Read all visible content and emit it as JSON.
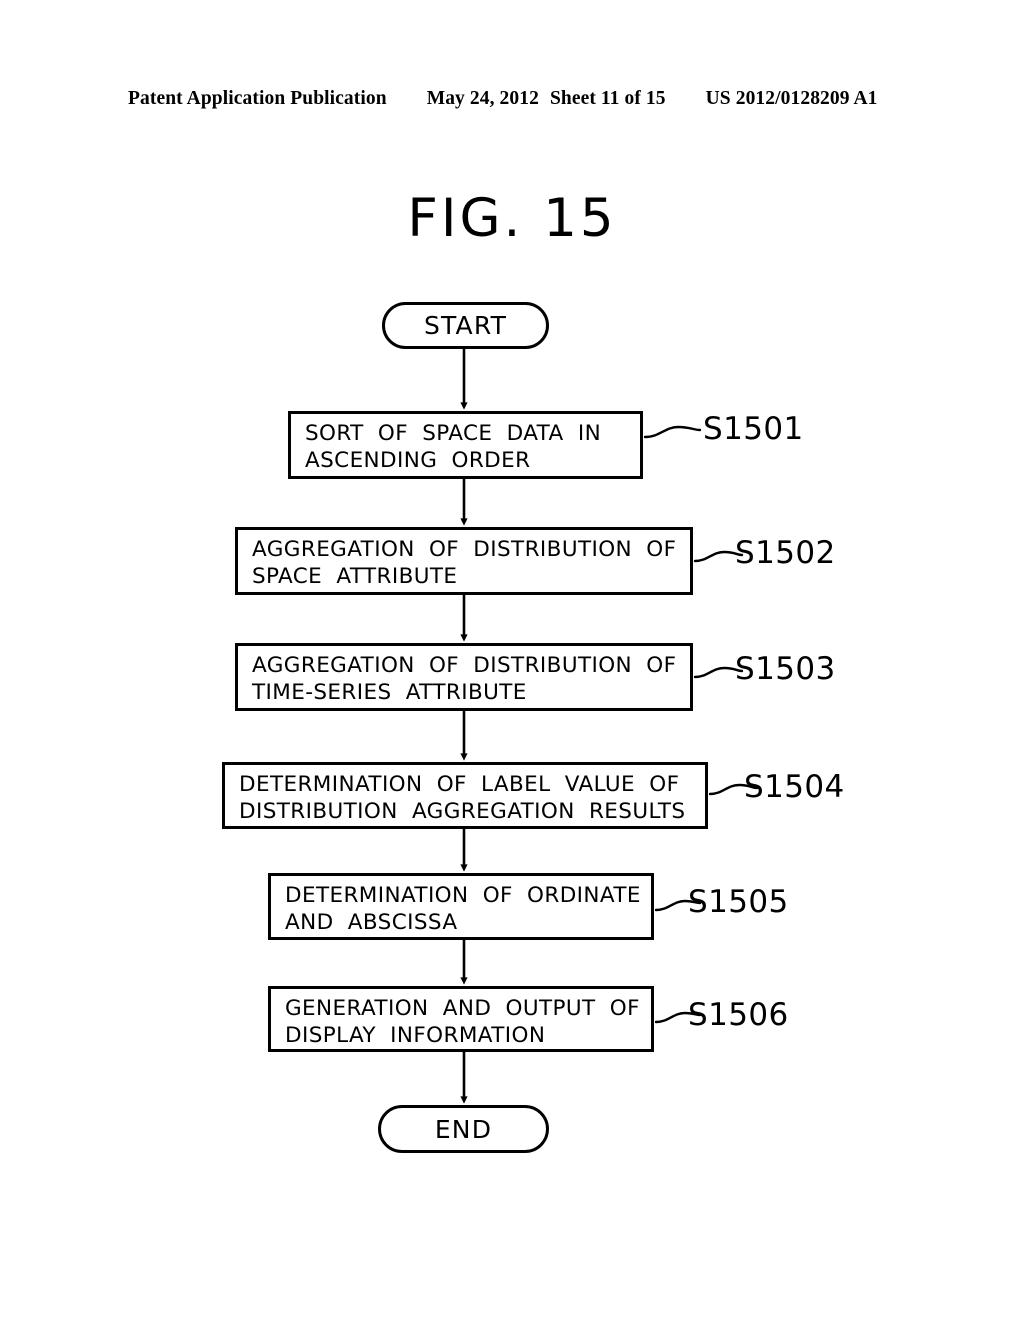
{
  "header": {
    "publication": "Patent Application Publication",
    "date": "May 24, 2012",
    "sheet": "Sheet 11 of 15",
    "document_number": "US 2012/0128209 A1"
  },
  "figure": {
    "title": "FIG.  15"
  },
  "flowchart": {
    "start_label": "START",
    "end_label": "END",
    "steps": [
      {
        "id": "S1501",
        "text": "SORT OF SPACE DATA IN\nASCENDING ORDER"
      },
      {
        "id": "S1502",
        "text": "AGGREGATION OF DISTRIBUTION OF\nSPACE ATTRIBUTE"
      },
      {
        "id": "S1503",
        "text": "AGGREGATION OF DISTRIBUTION OF\nTIME-SERIES ATTRIBUTE"
      },
      {
        "id": "S1504",
        "text": "DETERMINATION OF LABEL VALUE OF\nDISTRIBUTION AGGREGATION RESULTS"
      },
      {
        "id": "S1505",
        "text": "DETERMINATION OF ORDINATE\nAND ABSCISSA"
      },
      {
        "id": "S1506",
        "text": "GENERATION AND OUTPUT OF\nDISPLAY INFORMATION"
      }
    ]
  },
  "colors": {
    "ink": "#000000",
    "paper": "#ffffff"
  }
}
